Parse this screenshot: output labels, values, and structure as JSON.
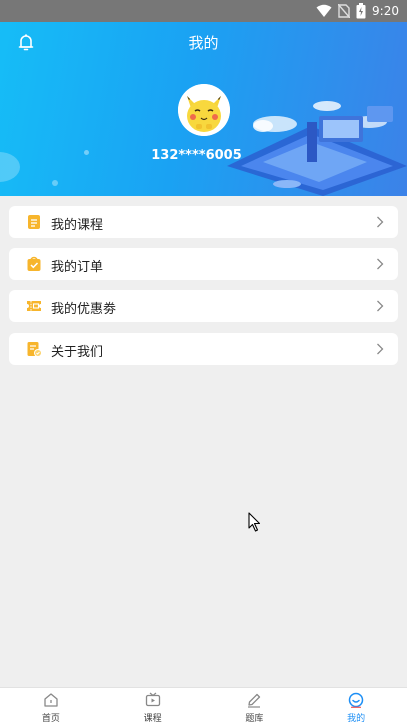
{
  "status_bar": {
    "time": "9:20"
  },
  "header": {
    "title": "我的",
    "phone": "132****6005"
  },
  "menu": [
    {
      "label": "我的课程",
      "icon": "course-icon",
      "color": "#f7b52c"
    },
    {
      "label": "我的订单",
      "icon": "order-icon",
      "color": "#f7b52c"
    },
    {
      "label": "我的优惠劵",
      "icon": "coupon-icon",
      "color": "#f7b52c"
    },
    {
      "label": "关于我们",
      "icon": "about-icon",
      "color": "#f7b52c"
    }
  ],
  "tabs": [
    {
      "label": "首页",
      "icon": "home-icon",
      "active": false
    },
    {
      "label": "课程",
      "icon": "tv-icon",
      "active": false
    },
    {
      "label": "题库",
      "icon": "pencil-icon",
      "active": false
    },
    {
      "label": "我的",
      "icon": "smile-icon",
      "active": true
    }
  ],
  "colors": {
    "accent": "#1c8ef5",
    "header_start": "#16bdf7",
    "header_end": "#3c82e8",
    "menu_icon": "#f7b52c"
  }
}
